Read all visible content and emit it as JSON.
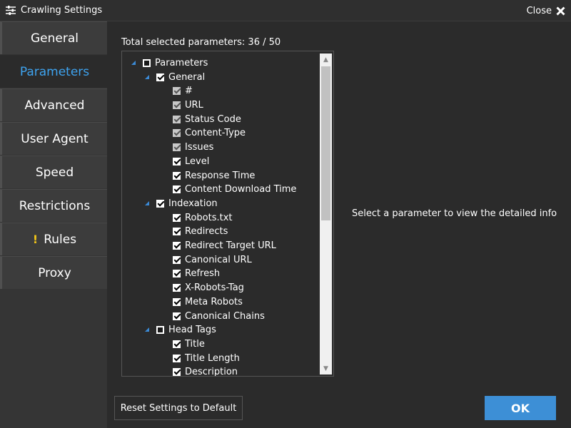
{
  "window": {
    "title": "Crawling Settings",
    "close_label": "Close"
  },
  "sidebar": {
    "items": [
      {
        "label": "General"
      },
      {
        "label": "Parameters",
        "active": true
      },
      {
        "label": "Advanced"
      },
      {
        "label": "User Agent"
      },
      {
        "label": "Speed"
      },
      {
        "label": "Restrictions"
      },
      {
        "label": "Rules",
        "warning": "!"
      },
      {
        "label": "Proxy"
      }
    ]
  },
  "main": {
    "total_label": "Total selected parameters: 36 / 50",
    "detail_info": "Select a parameter to view the detailed info",
    "tree": {
      "root": {
        "label": "Parameters",
        "checked": false
      },
      "groups": [
        {
          "label": "General",
          "checked": true,
          "items": [
            {
              "label": "#",
              "checked": true,
              "disabled": true
            },
            {
              "label": "URL",
              "checked": true,
              "disabled": true
            },
            {
              "label": "Status Code",
              "checked": true,
              "disabled": true
            },
            {
              "label": "Content-Type",
              "checked": true,
              "disabled": true
            },
            {
              "label": "Issues",
              "checked": true,
              "disabled": true
            },
            {
              "label": "Level",
              "checked": true
            },
            {
              "label": "Response Time",
              "checked": true
            },
            {
              "label": "Content Download Time",
              "checked": true
            }
          ]
        },
        {
          "label": "Indexation",
          "checked": true,
          "items": [
            {
              "label": "Robots.txt",
              "checked": true
            },
            {
              "label": "Redirects",
              "checked": true
            },
            {
              "label": "Redirect Target URL",
              "checked": true
            },
            {
              "label": "Canonical URL",
              "checked": true
            },
            {
              "label": "Refresh",
              "checked": true
            },
            {
              "label": "X-Robots-Tag",
              "checked": true
            },
            {
              "label": "Meta Robots",
              "checked": true
            },
            {
              "label": "Canonical Chains",
              "checked": true
            }
          ]
        },
        {
          "label": "Head Tags",
          "checked": false,
          "items": [
            {
              "label": "Title",
              "checked": true
            },
            {
              "label": "Title Length",
              "checked": true
            },
            {
              "label": "Description",
              "checked": true
            }
          ]
        }
      ]
    }
  },
  "footer": {
    "reset_label": "Reset Settings to Default",
    "ok_label": "OK"
  },
  "colors": {
    "accent": "#3ea3ef",
    "ok_button": "#3d8fd6",
    "warning": "#f0c419"
  }
}
